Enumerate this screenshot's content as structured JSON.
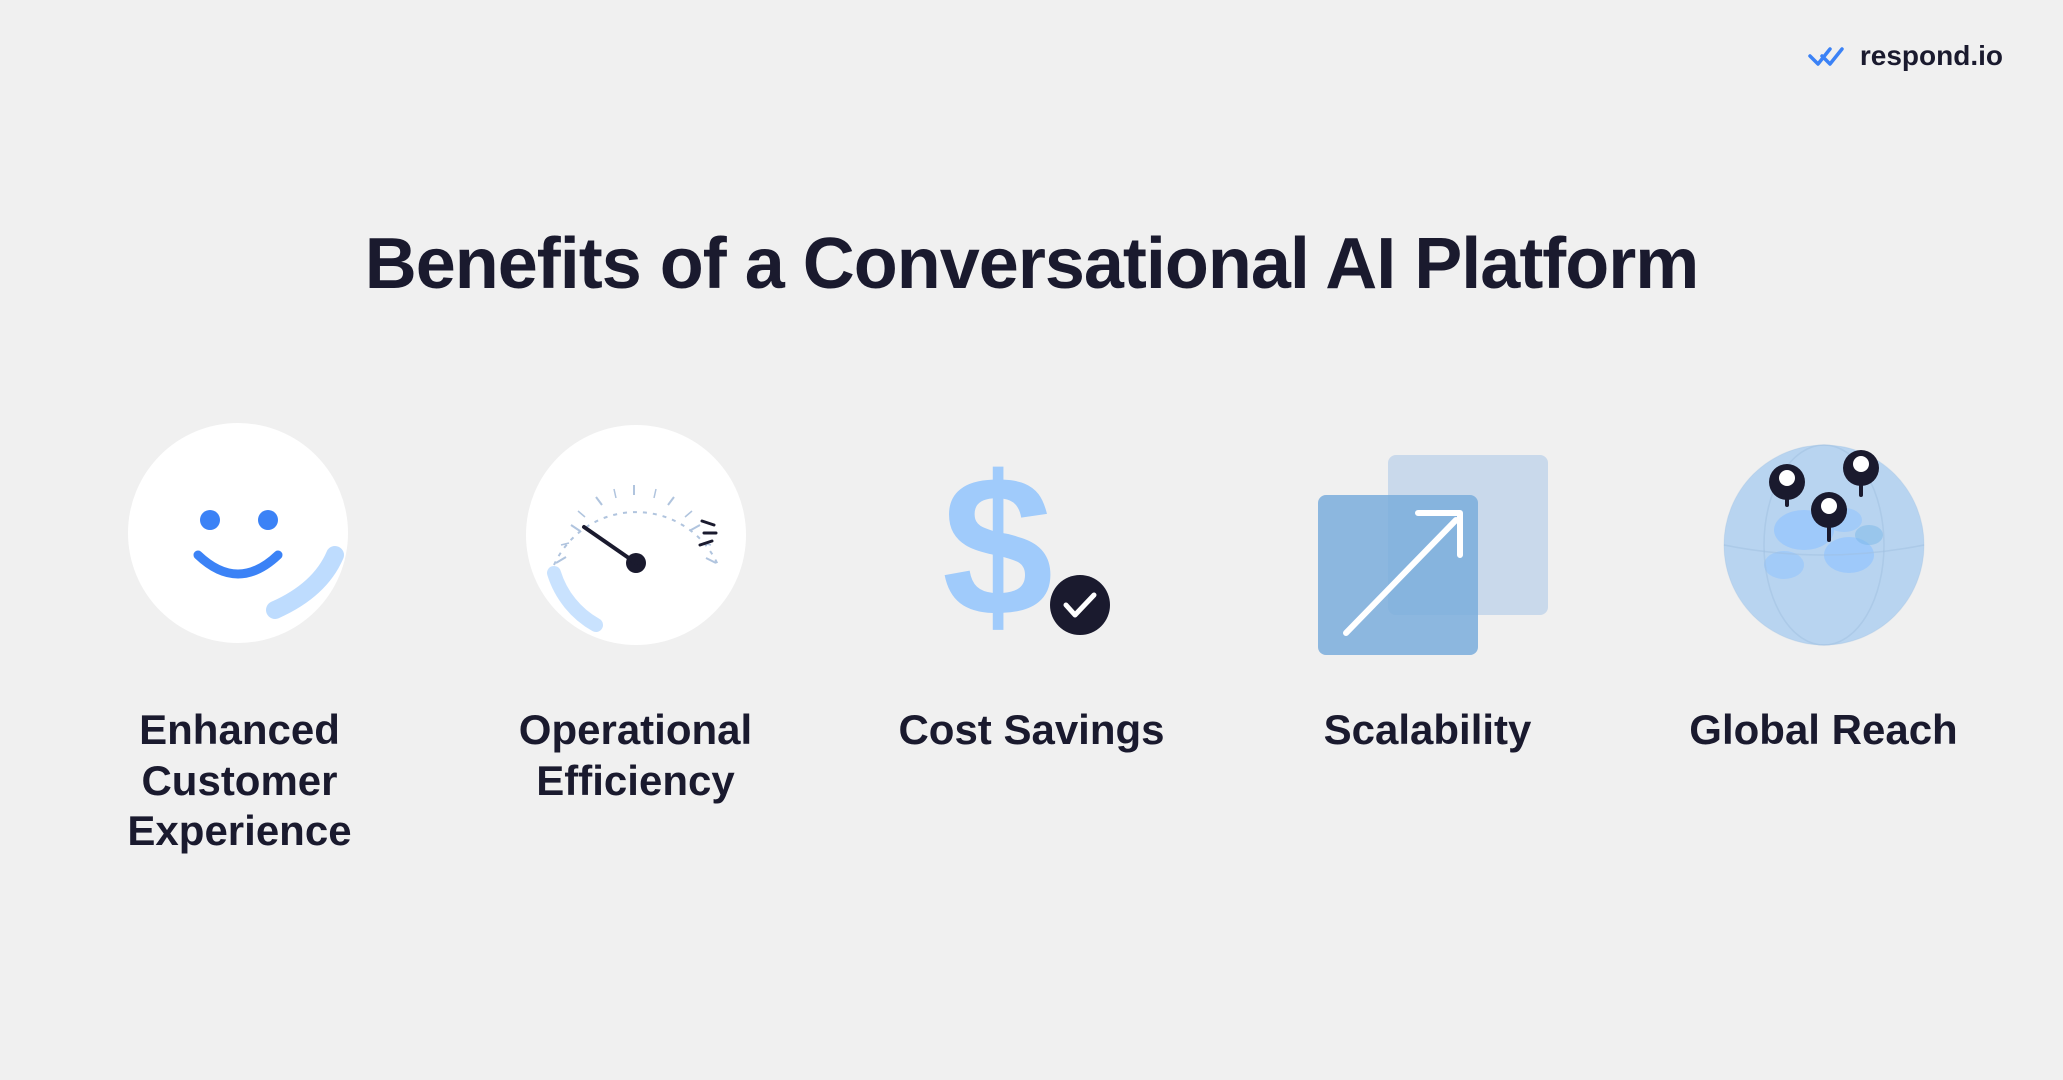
{
  "logo": {
    "text": "respond.io",
    "icon": "✓✓"
  },
  "title": "Benefits of a Conversational AI Platform",
  "benefits": [
    {
      "id": "customer-experience",
      "label": "Enhanced Customer Experience",
      "icon_type": "smiley"
    },
    {
      "id": "operational-efficiency",
      "label": "Operational Efficiency",
      "icon_type": "speedometer"
    },
    {
      "id": "cost-savings",
      "label": "Cost Savings",
      "icon_type": "dollar"
    },
    {
      "id": "scalability",
      "label": "Scalability",
      "icon_type": "chart"
    },
    {
      "id": "global-reach",
      "label": "Global Reach",
      "icon_type": "globe"
    }
  ],
  "colors": {
    "primary_blue": "#3b82f6",
    "light_blue": "#93c5fd",
    "bg": "#eeeeee",
    "dark": "#1a1a2e"
  }
}
